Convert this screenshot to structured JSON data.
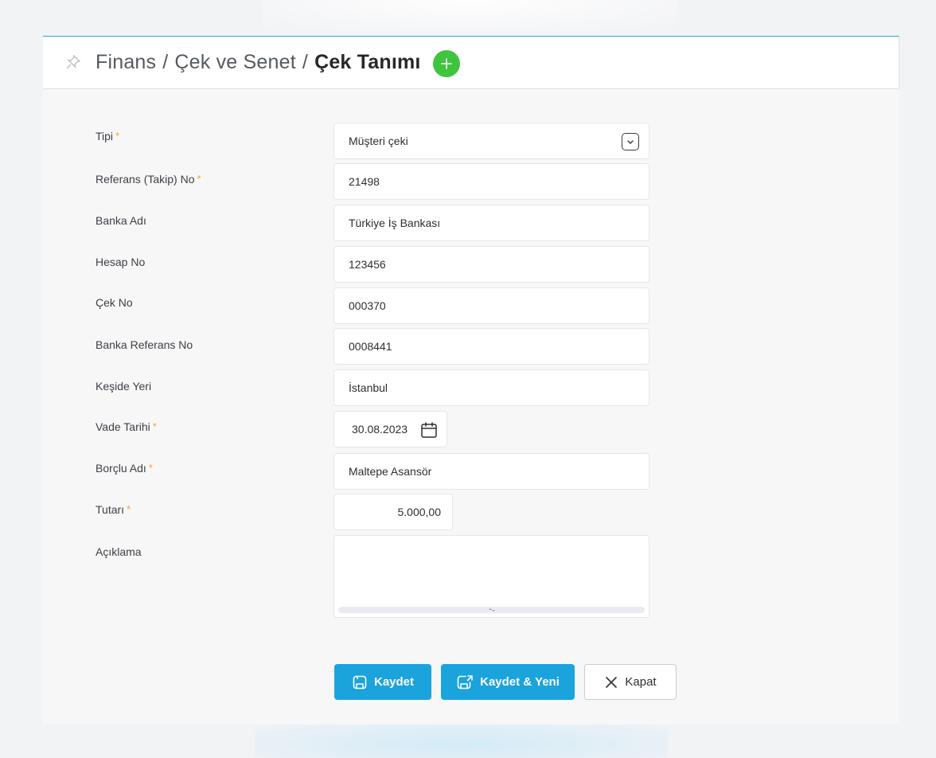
{
  "breadcrumb": {
    "part1": "Finans",
    "separator": "/",
    "part2": "Çek ve Senet",
    "current": "Çek Tanımı"
  },
  "form": {
    "required_mark": "*",
    "tipi": {
      "label": "Tipi",
      "value": "Müşteri çeki"
    },
    "referans": {
      "label": "Referans (Takip) No",
      "value": "21498"
    },
    "banka_adi": {
      "label": "Banka Adı",
      "value": "Türkiye İş Bankası"
    },
    "hesap_no": {
      "label": "Hesap No",
      "value": "123456"
    },
    "cek_no": {
      "label": "Çek No",
      "value": "000370"
    },
    "banka_referans": {
      "label": "Banka Referans No",
      "value": "0008441"
    },
    "keside_yeri": {
      "label": "Keşide Yeri",
      "value": "İstanbul"
    },
    "vade_tarihi": {
      "label": "Vade Tarihi",
      "value": "30.08.2023"
    },
    "borclu_adi": {
      "label": "Borçlu Adı",
      "value": "Maltepe Asansör"
    },
    "tutari": {
      "label": "Tutarı",
      "value": "5.000,00"
    },
    "aciklama": {
      "label": "Açıklama",
      "value": ""
    }
  },
  "buttons": {
    "save": "Kaydet",
    "save_new": "Kaydet & Yeni",
    "close": "Kapat"
  },
  "colors": {
    "accent": "#1ba3dc",
    "add": "#3ec43e",
    "required": "#f5a623"
  }
}
